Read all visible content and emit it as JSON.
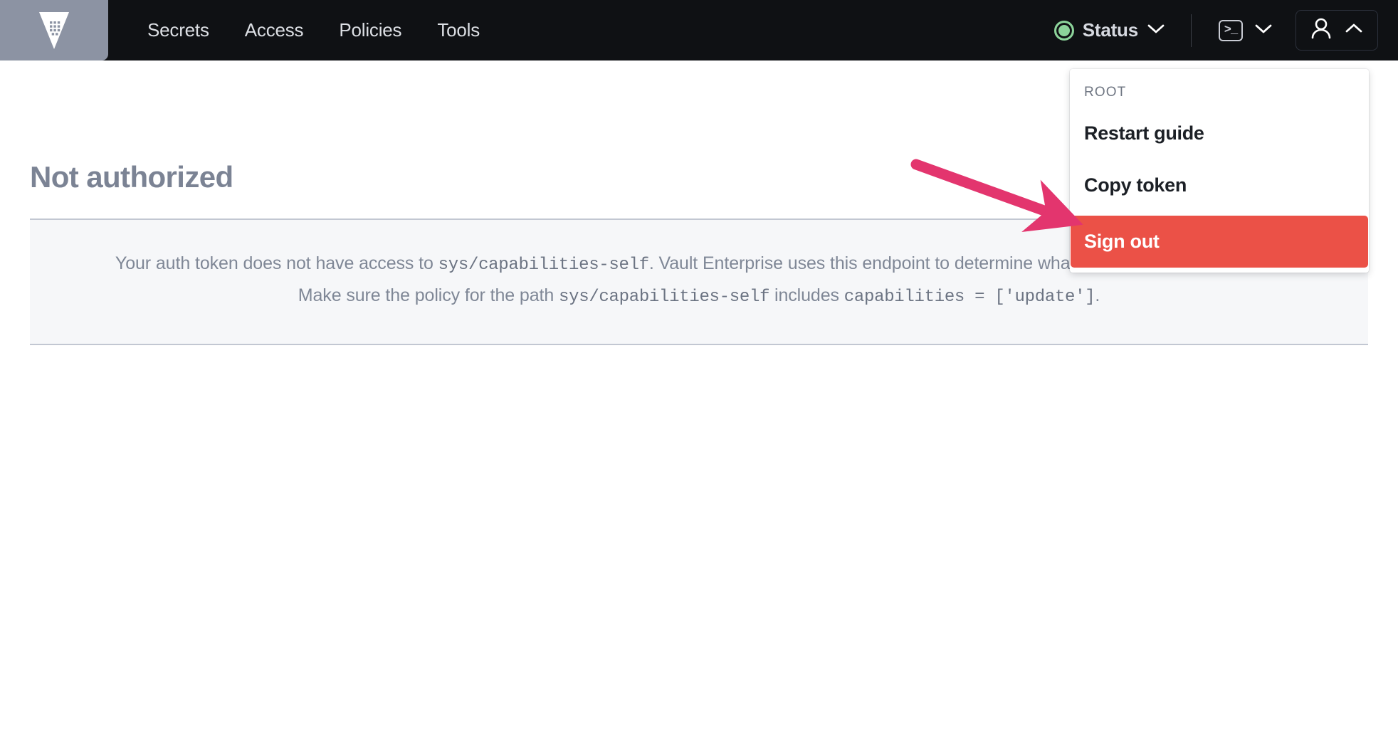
{
  "app": {
    "logo_icon": "vault-logo-icon",
    "logo_name": "HashiCorp Vault"
  },
  "navbar": {
    "links": [
      {
        "label": "Secrets",
        "name": "nav-link-secrets"
      },
      {
        "label": "Access",
        "name": "nav-link-access"
      },
      {
        "label": "Policies",
        "name": "nav-link-policies"
      },
      {
        "label": "Tools",
        "name": "nav-link-tools"
      }
    ],
    "status": {
      "label": "Status",
      "indicator_color": "#8cd39a",
      "chevron_icon": "chevron-down-icon"
    },
    "console": {
      "icon": "console-terminal-icon",
      "glyph": ">_",
      "chevron_icon": "chevron-down-icon"
    },
    "user": {
      "icon": "user-avatar-icon",
      "chevron_icon": "chevron-up-icon"
    },
    "background_color": "#0f1114",
    "logo_tile_color": "#8c93a3"
  },
  "main": {
    "title": "Not authorized",
    "message": {
      "line1_pre": "Your auth token does not have access to ",
      "line1_code": "sys/capabilities-self",
      "line1_post": ". Vault Enterprise uses this endpoint to determine what is allowed in the interface.",
      "line2_pre": "Make sure the policy for the path ",
      "line2_code": "sys/capabilities-self",
      "line2_mid": " includes ",
      "line2_code2": "capabilities = ['update']",
      "line2_post": "."
    },
    "card_background": "#f6f7f9",
    "title_color": "#7b8394"
  },
  "user_menu": {
    "section_label": "ROOT",
    "items": [
      {
        "label": "Restart guide",
        "name": "menu-item-restart-guide",
        "danger": false
      },
      {
        "label": "Copy token",
        "name": "menu-item-copy-token",
        "danger": false
      },
      {
        "label": "Sign out",
        "name": "menu-item-sign-out",
        "danger": true
      }
    ],
    "danger_color": "#eb5147"
  },
  "annotation": {
    "arrow_color": "#e3356e",
    "arrow_target": "Sign out",
    "name": "annotation-arrow"
  }
}
